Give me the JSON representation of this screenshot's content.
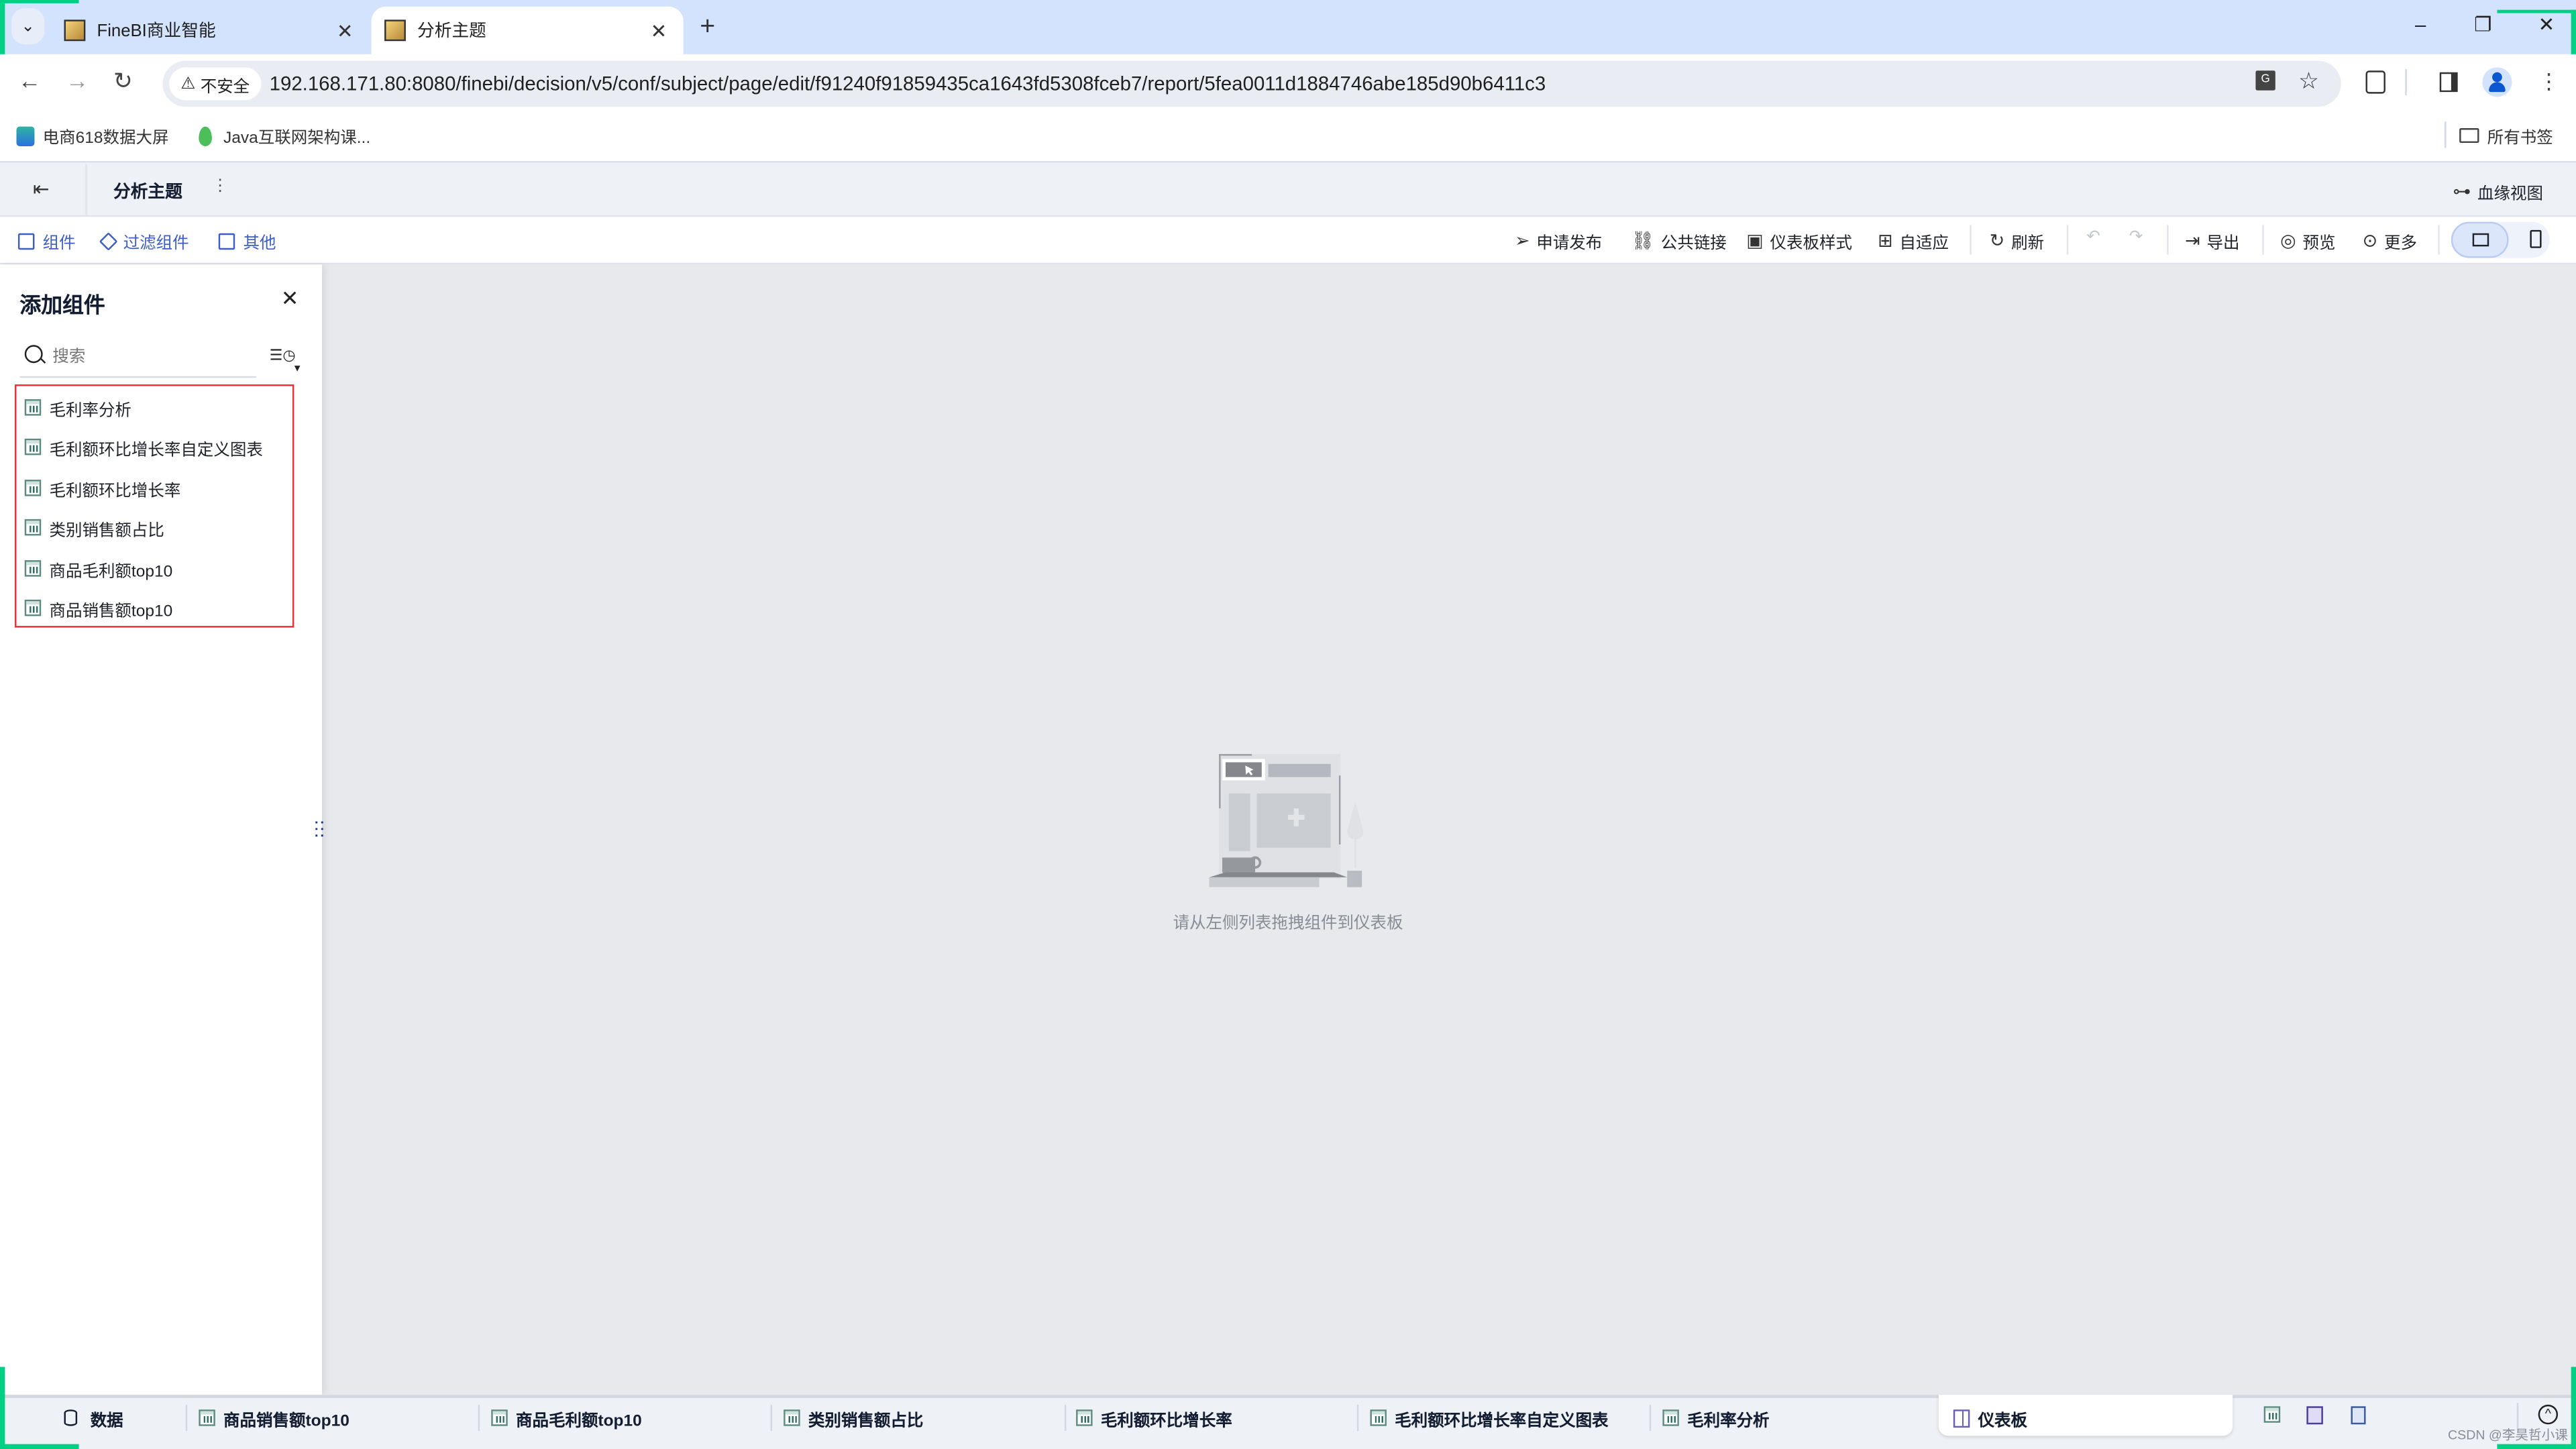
{
  "browser": {
    "tabs": [
      {
        "title": "FineBI商业智能",
        "active": false
      },
      {
        "title": "分析主题",
        "active": true
      }
    ],
    "new_tab_label": "+",
    "security_label": "不安全",
    "url": "192.168.171.80:8080/finebi/decision/v5/conf/subject/page/edit/f91240f91859435ca1643fd5308fceb7/report/5fea0011d1884746abe185d90b6411c3",
    "bookmarks": [
      {
        "label": "电商618数据大屏",
        "icon": "dashboard-app-icon"
      },
      {
        "label": "Java互联网架构课...",
        "icon": "leaf-icon"
      }
    ],
    "all_bookmarks_label": "所有书签",
    "window_controls": {
      "minimize": "–",
      "restore": "❐",
      "close": "✕"
    }
  },
  "header": {
    "title": "分析主题",
    "more_icon": "⋮",
    "lineage_label": "血缘视图"
  },
  "toolbar": {
    "left": [
      {
        "label": "组件",
        "icon": "component-icon"
      },
      {
        "label": "过滤组件",
        "icon": "filter-component-icon"
      },
      {
        "label": "其他",
        "icon": "other-icon"
      }
    ],
    "right": {
      "publish": "申请发布",
      "public_link": "公共链接",
      "dashboard_style": "仪表板样式",
      "adaptive": "自适应",
      "refresh": "刷新",
      "export": "导出",
      "preview": "预览",
      "more": "更多"
    },
    "view_mode": "desktop"
  },
  "panel": {
    "title": "添加组件",
    "search_placeholder": "搜索",
    "components": [
      "毛利率分析",
      "毛利额环比增长率自定义图表",
      "毛利额环比增长率",
      "类别销售额占比",
      "商品毛利额top10",
      "商品销售额top10"
    ]
  },
  "canvas": {
    "empty_text": "请从左侧列表拖拽组件到仪表板"
  },
  "bottom": {
    "data_label": "数据",
    "tabs": [
      "商品销售额top10",
      "商品毛利额top10",
      "类别销售额占比",
      "毛利额环比增长率",
      "毛利额环比增长率自定义图表",
      "毛利率分析"
    ],
    "dashboard_tab": "仪表板",
    "watermark": "CSDN @李昊哲小课"
  }
}
